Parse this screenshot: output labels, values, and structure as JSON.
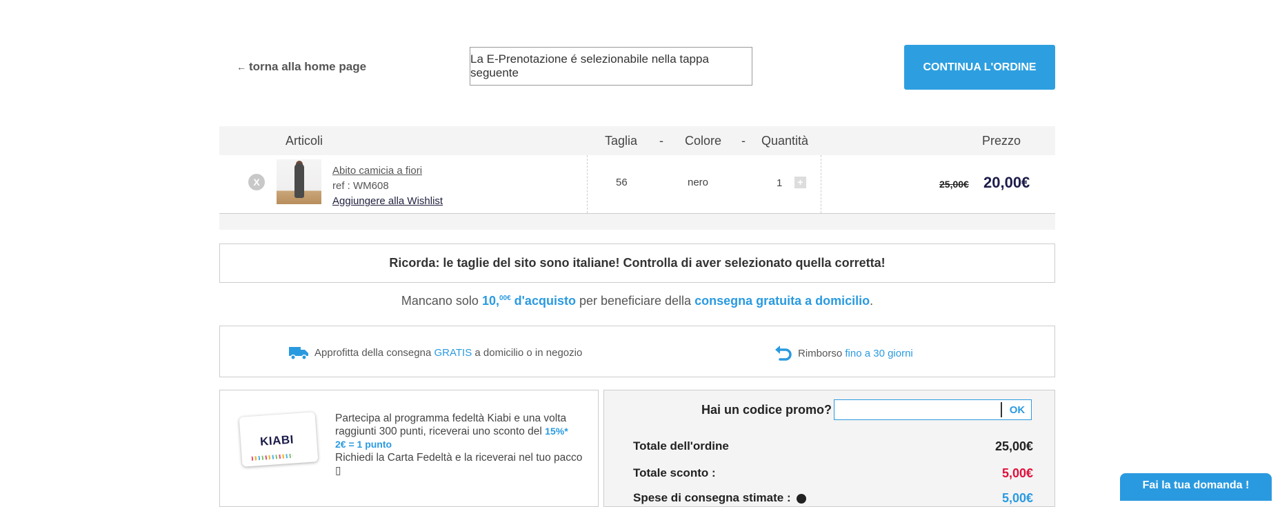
{
  "header": {
    "back_arrow": "←",
    "back_label": "torna alla home page",
    "eprenotazione_notice": "La E-Prenotazione é selezionabile nella tappa seguente",
    "continue_label": "CONTINUA L'ORDINE"
  },
  "cart_table": {
    "headers": {
      "articles": "Articoli",
      "size": "Taglia",
      "sep1": "-",
      "color": "Colore",
      "sep2": "-",
      "quantity": "Quantità",
      "price": "Prezzo"
    },
    "item": {
      "remove_label": "X",
      "name": "Abito camicia a fiori",
      "ref": "ref : WM608",
      "wishlist_label": "Aggiungere alla Wishlist",
      "size": "56",
      "color": "nero",
      "quantity": "1",
      "qty_plus": "+",
      "old_price": "25,00€",
      "new_price": "20,00€"
    }
  },
  "reminder": "Ricorda: le taglie del sito sono italiane! Controlla di aver selezionato quella corretta!",
  "free_shipping": {
    "prefix": "Mancano solo ",
    "amount_int": "10,",
    "amount_dec": "00€",
    "amount_suffix": " d'acquisto",
    "middle": " per beneficiare della ",
    "highlight": "consegna gratuita a domicilio",
    "end": "."
  },
  "benefits": {
    "delivery_prefix": "Approfitta della consegna ",
    "delivery_highlight": "GRATIS",
    "delivery_suffix": " a domicilio o in negozio",
    "refund_prefix": "Rimborso ",
    "refund_highlight": "fino a 30 giorni",
    "truck_icon": "truck-icon",
    "return_icon": "return-arrow-icon"
  },
  "fidelity": {
    "card_logo": "KIABI",
    "text1": "Partecipa al programma fedeltà Kiabi e una volta raggiunti 300 punti, riceverai uno sconto del ",
    "discount": "15%*",
    "points_rule": "2€ = 1 punto",
    "text2": "Richiedi la Carta Fedeltà e la riceverai nel tuo pacco ",
    "trailing_glyph": "▯"
  },
  "summary": {
    "promo_label": "Hai un codice promo?",
    "promo_value": "",
    "promo_ok": "OK",
    "order_total_label": "Totale dell'ordine",
    "order_total_value": "25,00€",
    "discount_label": "Totale sconto :",
    "discount_value": "5,00€",
    "shipping_label": "Spese di consegna stimate :",
    "shipping_value": "5,00€",
    "colors": {
      "discount": "#e0103a",
      "shipping": "#2a9ae0"
    }
  },
  "chat_label": "Fai la tua domanda !"
}
